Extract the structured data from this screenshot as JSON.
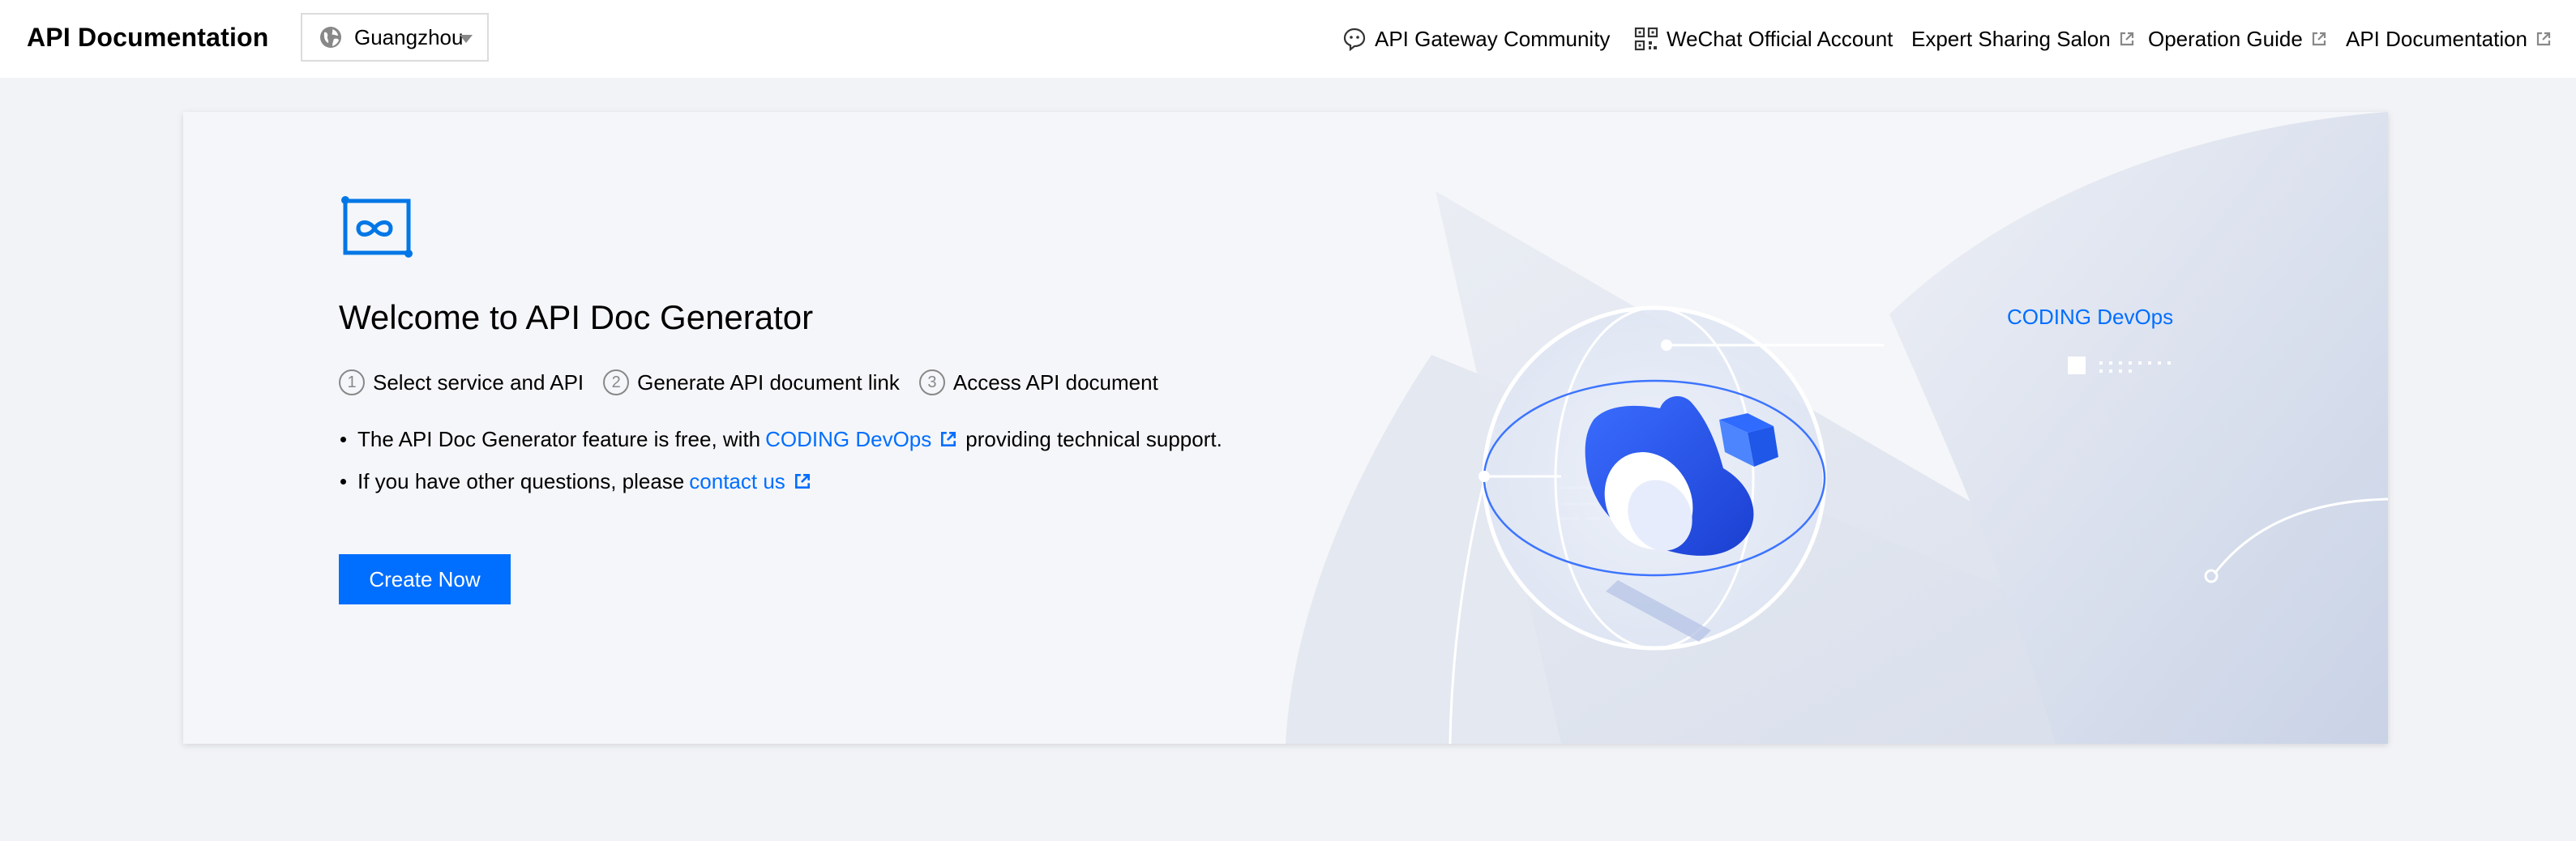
{
  "header": {
    "title": "API Documentation",
    "region": {
      "selected": "Guangzhou"
    },
    "links": [
      {
        "label": "API Gateway Community",
        "icon": "chat-bubble-icon",
        "external": false
      },
      {
        "label": "WeChat Official Account",
        "icon": "qr-code-icon",
        "external": false
      },
      {
        "label": "Expert Sharing Salon",
        "external": true
      },
      {
        "label": "Operation Guide",
        "external": true
      },
      {
        "label": "API Documentation",
        "external": true
      }
    ]
  },
  "card": {
    "welcome": "Welcome to API Doc Generator",
    "steps": [
      {
        "num": "1",
        "label": "Select service and API"
      },
      {
        "num": "2",
        "label": "Generate API document link"
      },
      {
        "num": "3",
        "label": "Access API document"
      }
    ],
    "bullet1": {
      "before": "The API Doc Generator feature is free, with",
      "link": "CODING DevOps",
      "after": "providing technical support."
    },
    "bullet2": {
      "before": "If you have other questions, please",
      "link": "contact us"
    },
    "create_button": "Create Now",
    "illustration_label": "CODING DevOps"
  },
  "colors": {
    "accent": "#006eff",
    "page_bg": "#f2f3f7",
    "card_bg": "#f5f6f9"
  }
}
